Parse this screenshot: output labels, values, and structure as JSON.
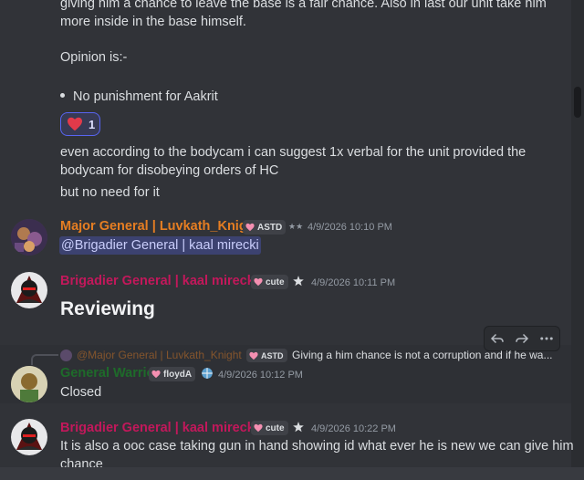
{
  "messages": {
    "top_line1": "giving him a chance to leave the base is a fair chance. Also in last our unit take him",
    "top_line2": "more inside in the base himself.",
    "opinion_label": "Opinion is:-",
    "bullet": "No punishment for Aakrit",
    "reaction_count": "1",
    "body_line1": "even according to the bodycam i can suggest 1x verbal for the unit provided the",
    "body_line2": "bodycam for disobeying orders of HC",
    "body_line3": "but no need for it"
  },
  "msg_luvkath": {
    "author": "Major General | Luvkath_Knight",
    "tag": "ASTD",
    "badge": "★★",
    "timestamp": "4/9/2026 10:10 PM",
    "mention": "@Brigadier General | kaal mirecki",
    "name_color": "#e67e22"
  },
  "msg_kaal_1": {
    "author": "Brigadier General | kaal mirecki",
    "tag": "cute",
    "timestamp": "4/9/2026 10:11 PM",
    "heading": "Reviewing",
    "name_color": "#c2185b"
  },
  "msg_reply": {
    "reply_author": "@Major General | Luvkath_Knight",
    "reply_tag": "ASTD",
    "reply_preview": "Giving a him chance is not a corruption and if he wa...",
    "author": "General Warrior",
    "tag": "floydA",
    "timestamp": "4/9/2026 10:12 PM",
    "text": "Closed",
    "name_color": "#1e6b2a"
  },
  "msg_kaal_2": {
    "author": "Brigadier General | kaal mirecki",
    "tag": "cute",
    "timestamp": "4/9/2026 10:22 PM",
    "line1": "It is also a ooc case taking gun in hand showing id what ever he is new we can give him",
    "line2": "chance",
    "name_color": "#c2185b"
  },
  "colors": {
    "background": "#313338",
    "text": "#dbdee1",
    "timestamp": "#949ba4",
    "mention_bg": "#3c4270",
    "reaction_border": "#5865f2"
  },
  "icons": {
    "reaction": "heart-icon",
    "toolbar": [
      "reply-icon",
      "forward-icon",
      "more-icon"
    ]
  }
}
